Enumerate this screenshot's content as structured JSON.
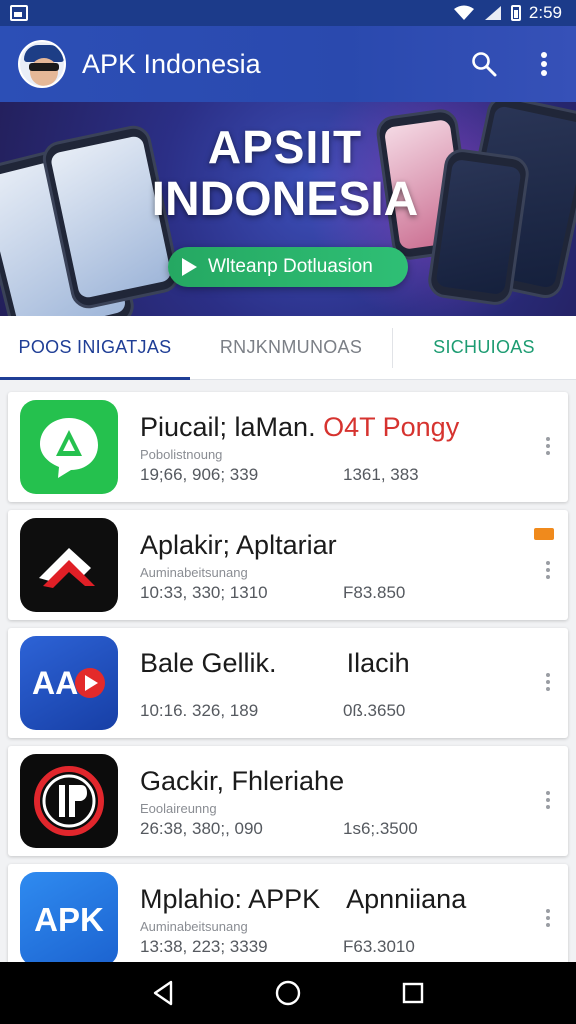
{
  "status_bar": {
    "time": "2:59",
    "icons": [
      "screenshot-icon",
      "wifi-icon",
      "signal-icon",
      "battery-icon"
    ]
  },
  "app_bar": {
    "title": "APK Indonesia",
    "icons": [
      "avatar",
      "search-icon",
      "more-vert-icon"
    ]
  },
  "banner": {
    "line1": "APSIIT",
    "line2": "INDONESIA",
    "button_label": "Wlteanp Dotluasion"
  },
  "tabs": [
    {
      "label": "POOS INIGATJAS",
      "active": true
    },
    {
      "label": "RNJKNMUNOAS",
      "active": false
    },
    {
      "label": "SICHUIOAS",
      "active": false
    }
  ],
  "apps": [
    {
      "name": "Piucail; laMan.",
      "name_extra": "O4T Pongy",
      "subtitle": "Pobolistnoung",
      "meta_left": "19;66, 906; 339",
      "meta_right": "1361, 383",
      "icon": "green-chat-icon",
      "badge": false
    },
    {
      "name": "Aplakir; Apltariar",
      "name_extra": "",
      "subtitle": "Auminabeitsunang",
      "meta_left": "10:33, 330; 1310",
      "meta_right": "F83.850",
      "icon": "red-arrow-logo-icon",
      "badge": true
    },
    {
      "name": "Bale Gellik.",
      "name_extra": "Ilacih",
      "subtitle": "",
      "meta_left": "10:16. 326, 189",
      "meta_right": "0ß.3650",
      "icon": "ad-play-logo-icon",
      "badge": false
    },
    {
      "name": "Gackir, Fhleriahe",
      "name_extra": "",
      "subtitle": "Eoolaireunng",
      "meta_left": "26:38, 380;, 090",
      "meta_right": "1s6;.3500",
      "icon": "red-ring-logo-icon",
      "badge": false
    },
    {
      "name": "Mplahio: APPK",
      "name_extra": "Apnniiana",
      "subtitle": "Auminabeitsunang",
      "meta_left": "13:38, 223; 3339",
      "meta_right": "F63.3010",
      "icon": "apk-logo-icon",
      "badge": false
    }
  ],
  "nav_bar": {
    "icons": [
      "back-icon",
      "home-icon",
      "recents-icon"
    ]
  },
  "colors": {
    "app_bar": "#2c4fb6",
    "active_tab": "#1f3e96",
    "green_tab": "#1d9c72",
    "accent_red": "#d6332f",
    "button_green": "#2fbf75"
  }
}
